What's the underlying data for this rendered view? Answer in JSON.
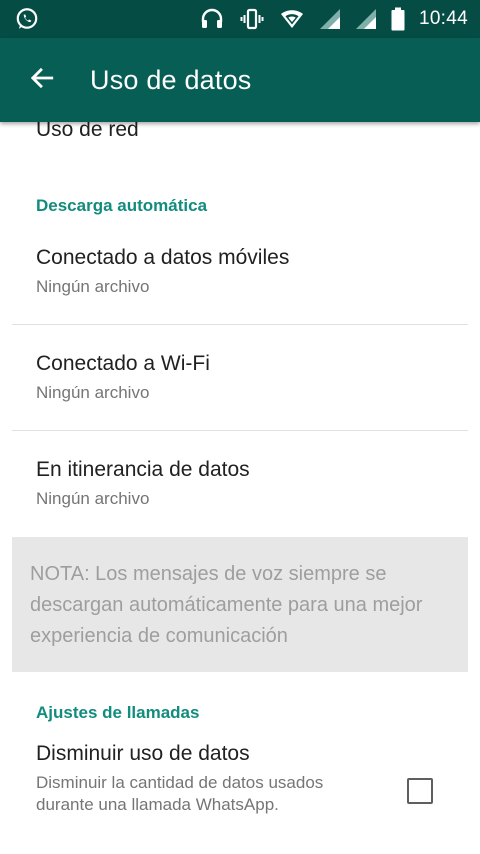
{
  "status_bar": {
    "time": "10:44",
    "icons": [
      "whatsapp-notification-icon",
      "headphones-icon",
      "vibrate-icon",
      "wifi-icon",
      "signal-icon",
      "signal-icon-2",
      "battery-icon"
    ]
  },
  "app_bar": {
    "back_icon": "arrow-back-icon",
    "title": "Uso de datos"
  },
  "network_usage": {
    "label": "Uso de red"
  },
  "auto_download": {
    "header": "Descarga automática",
    "items": [
      {
        "title": "Conectado a datos móviles",
        "summary": "Ningún archivo"
      },
      {
        "title": "Conectado a Wi-Fi",
        "summary": "Ningún archivo"
      },
      {
        "title": "En itinerancia de datos",
        "summary": "Ningún archivo"
      }
    ],
    "note": "NOTA: Los mensajes de voz siempre se descargan automáticamente para una mejor experiencia de comunicación"
  },
  "call_settings": {
    "header": "Ajustes de llamadas",
    "low_data": {
      "title": "Disminuir uso de datos",
      "summary": "Disminuir la cantidad de datos usados durante una llamada WhatsApp.",
      "checked": false
    }
  },
  "colors": {
    "status_bar": "#054d44",
    "app_bar": "#075e54",
    "accent": "#128c7e"
  }
}
